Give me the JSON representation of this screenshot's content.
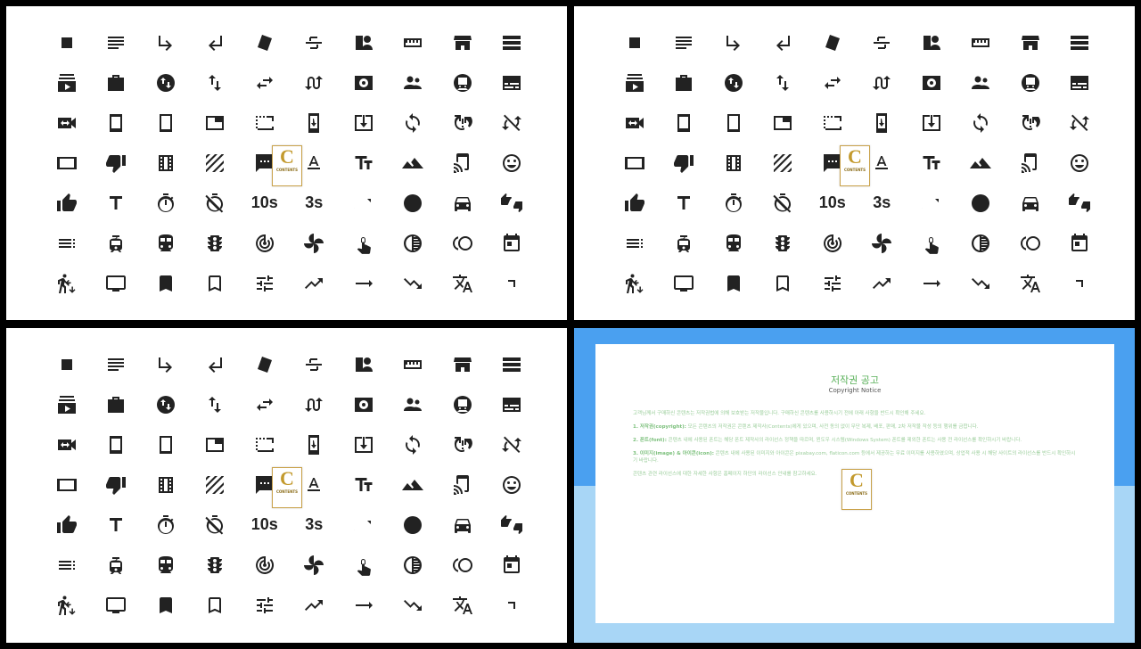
{
  "logo": {
    "letter": "C",
    "line1": "CONTENTS",
    "line2": ""
  },
  "text_icons": {
    "ten_s": "10s",
    "three_s": "3s"
  },
  "icon_rows": [
    [
      "square-icon",
      "notes-icon",
      "subdirectory-arrow-right-icon",
      "subdirectory-arrow-left-icon",
      "style-icon",
      "strikethrough-icon",
      "switch-account-icon",
      "straighten-icon",
      "storefront-icon",
      "storage-icon"
    ],
    [
      "subscriptions-icon",
      "swap-horizontal-case-icon",
      "swap-vertical-circle-icon",
      "swap-vert-icon",
      "swap-horiz-icon",
      "swap-calls-icon",
      "surround-sound-icon",
      "supervisor-account-icon",
      "subway-icon",
      "subtitles-icon"
    ],
    [
      "switch-video-icon",
      "tablet-icon",
      "tablet-android-icon",
      "tab-icon",
      "tab-unselected-icon",
      "system-update-icon",
      "system-update-alt-icon",
      "sync-icon",
      "sync-problem-icon",
      "sync-disabled-icon"
    ],
    [
      "tablet-landscape-icon",
      "thumb-down-icon",
      "theaters-icon",
      "texture-icon",
      "textsms-icon",
      "text-format-icon",
      "text-fields-icon",
      "terrain-icon",
      "tap-and-play-icon",
      "tag-faces-icon"
    ],
    [
      "thumb-up-icon",
      "title-icon",
      "timer-icon",
      "timer-off-icon",
      "timer-10s-icon",
      "timer-3s-icon",
      "timeline-icon",
      "tonality-icon",
      "time-to-leave-icon",
      "thumbs-up-down-icon"
    ],
    [
      "toc-icon",
      "tram-icon",
      "train-icon",
      "traffic-icon",
      "track-changes-icon",
      "toys-icon",
      "touch-app-icon",
      "tonality-half-icon",
      "toll-icon",
      "today-icon"
    ],
    [
      "transfer-within-a-station-icon",
      "tv-icon",
      "turned-in-icon",
      "turned-in-not-icon",
      "tune-icon",
      "trending-up-icon",
      "trending-flat-icon",
      "trending-down-icon",
      "translate-icon",
      "corner-icon"
    ]
  ],
  "notice": {
    "title": "저작권 공고",
    "subtitle": "Copyright Notice",
    "intro": "고객님께서 구매하신 콘텐츠는 저작권법에 의해 보호받는 저작물입니다. 구매하신 콘텐츠를 사용하시기 전에 아래 사항을 반드시 확인해 주세요.",
    "p1_head": "1. 저작권(copyright):",
    "p1": "모든 콘텐츠의 저작권은 콘텐츠 제작사(Contents)에게 있으며, 사전 동의 없이 무단 복제, 배포, 판매, 2차 저작물 작성 등의 행위를 금합니다.",
    "p2_head": "2. 폰트(font):",
    "p2": "콘텐츠 내에 사용된 폰트는 해당 폰트 제작사의 라이선스 정책을 따르며, 윈도우 시스템(Windows System) 폰트를 제외한 폰트는 사용 전 라이선스를 확인하시기 바랍니다.",
    "p3_head": "3. 이미지(image) & 아이콘(icon):",
    "p3": "콘텐츠 내에 사용된 이미지와 아이콘은 pixabay.com, flaticon.com 등에서 제공하는 무료 이미지를 사용하였으며, 상업적 사용 시 해당 사이트의 라이선스를 반드시 확인하시기 바랍니다.",
    "outro": "콘텐츠 관련 라이선스에 대한 자세한 사항은 홈페이지 하단의 라이선스 안내를 참고하세요."
  },
  "colors": {
    "icon": "#222222",
    "blue": "#4aa0f0",
    "light_blue": "#a8d6f6",
    "green": "#58b058",
    "gold": "#c39a2e"
  }
}
